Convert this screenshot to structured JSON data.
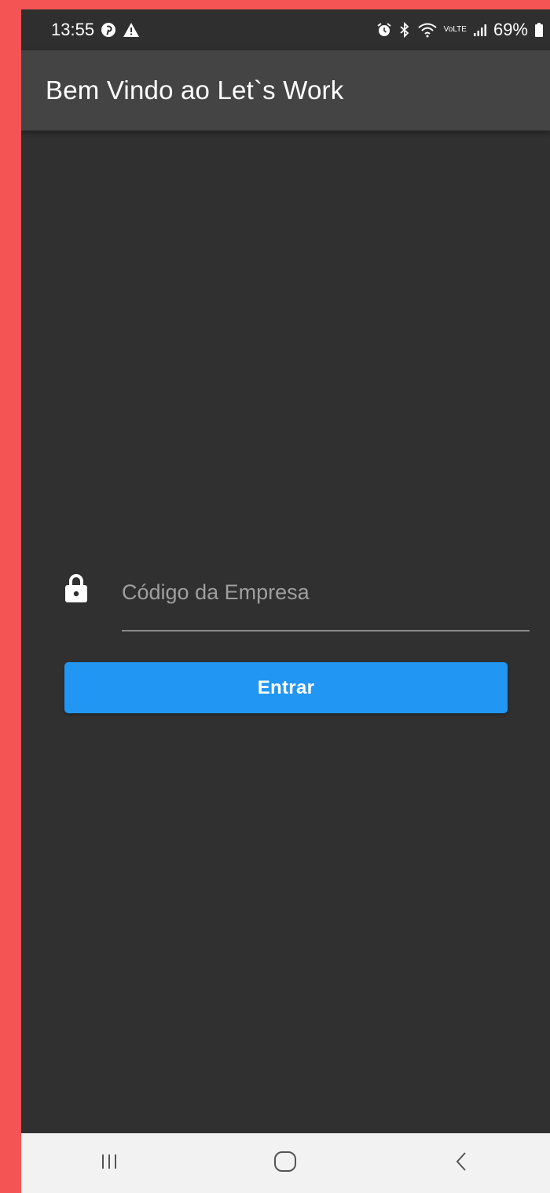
{
  "status_bar": {
    "time": "13:55",
    "battery": "69%",
    "network_label": "VoLTE"
  },
  "app_bar": {
    "title": "Bem Vindo ao Let`s Work"
  },
  "login": {
    "company_code_placeholder": "Código da Empresa",
    "company_code_value": "",
    "submit_label": "Entrar"
  },
  "colors": {
    "background": "#303030",
    "app_bar": "#444444",
    "accent": "#2196f3",
    "outer_frame": "#f55454"
  },
  "icons": {
    "left_status": [
      "pinterest-icon",
      "warning-icon"
    ],
    "right_status": [
      "alarm-icon",
      "bluetooth-icon",
      "wifi-icon",
      "signal-icon",
      "battery-icon"
    ],
    "field": "lock-icon",
    "nav": [
      "recent-apps-icon",
      "home-icon",
      "back-icon"
    ]
  }
}
